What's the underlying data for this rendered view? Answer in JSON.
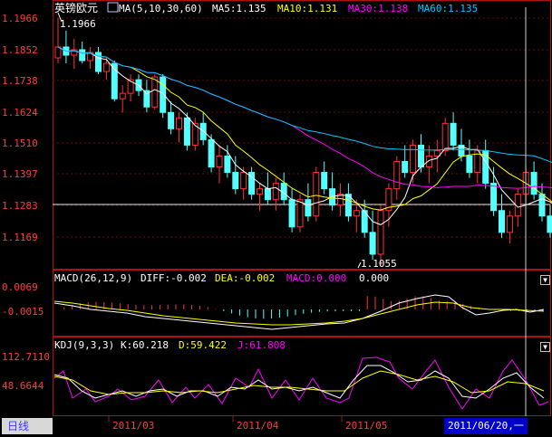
{
  "main_panel": {
    "symbol": "英镑欧元",
    "indicator": "MA(5,10,30,60)",
    "ma5": "MA5:1.135",
    "ma10": "MA10:1.131",
    "ma30": "MA30:1.138",
    "ma60": "MA60:1.135",
    "high_marker": "1.1966",
    "low_marker": "1.1055",
    "price_ticks": [
      "1.1966",
      "1.1852",
      "1.1738",
      "1.1624",
      "1.1510",
      "1.1397",
      "1.1283",
      "1.1169"
    ]
  },
  "macd_panel": {
    "indicator": "MACD(26,12,9)",
    "diff": "DIFF:-0.002",
    "dea": "DEA:-0.002",
    "macd": "MACD:0.000",
    "value": "0.000",
    "ticks": [
      "0.0069",
      "-0.0015"
    ]
  },
  "kdj_panel": {
    "indicator": "KDJ(9,3,3)",
    "k": "K:60.218",
    "d": "D:59.422",
    "j": "J:61.808",
    "ticks": [
      "112.7110",
      "48.6644"
    ]
  },
  "status_bar": {
    "period": "日线",
    "dates": [
      "2011/03",
      "2011/04",
      "2011/05"
    ],
    "cursor_date": "2011/06/20,一"
  },
  "colors": {
    "background": "#000000",
    "up": "#ff3232",
    "down": "#54ffff",
    "ma5": "#ffffff",
    "ma10": "#ffff00",
    "ma30": "#ff00ff",
    "ma60": "#00c8ff",
    "axis_text": "#ff3c3c"
  },
  "chart_data": {
    "type": "candlestick",
    "y_range": [
      1.105,
      1.1966
    ],
    "candles": [
      [
        1.182,
        1.1966,
        1.18,
        1.186
      ],
      [
        1.186,
        1.192,
        1.18,
        1.183
      ],
      [
        1.183,
        1.189,
        1.178,
        1.185
      ],
      [
        1.185,
        1.188,
        1.18,
        1.181
      ],
      [
        1.181,
        1.186,
        1.178,
        1.184
      ],
      [
        1.184,
        1.186,
        1.176,
        1.177
      ],
      [
        1.177,
        1.182,
        1.174,
        1.18
      ],
      [
        1.18,
        1.181,
        1.166,
        1.167
      ],
      [
        1.167,
        1.172,
        1.162,
        1.169
      ],
      [
        1.169,
        1.176,
        1.166,
        1.174
      ],
      [
        1.174,
        1.176,
        1.168,
        1.17
      ],
      [
        1.17,
        1.174,
        1.162,
        1.164
      ],
      [
        1.164,
        1.176,
        1.163,
        1.175
      ],
      [
        1.175,
        1.176,
        1.16,
        1.162
      ],
      [
        1.162,
        1.166,
        1.154,
        1.156
      ],
      [
        1.156,
        1.162,
        1.151,
        1.16
      ],
      [
        1.16,
        1.162,
        1.148,
        1.15
      ],
      [
        1.15,
        1.16,
        1.148,
        1.158
      ],
      [
        1.158,
        1.162,
        1.15,
        1.152
      ],
      [
        1.152,
        1.154,
        1.14,
        1.142
      ],
      [
        1.142,
        1.15,
        1.136,
        1.146
      ],
      [
        1.146,
        1.15,
        1.138,
        1.14
      ],
      [
        1.14,
        1.146,
        1.132,
        1.134
      ],
      [
        1.134,
        1.142,
        1.13,
        1.14
      ],
      [
        1.14,
        1.142,
        1.13,
        1.132
      ],
      [
        1.132,
        1.136,
        1.126,
        1.134
      ],
      [
        1.134,
        1.14,
        1.128,
        1.13
      ],
      [
        1.13,
        1.138,
        1.126,
        1.136
      ],
      [
        1.136,
        1.14,
        1.128,
        1.13
      ],
      [
        1.13,
        1.134,
        1.118,
        1.12
      ],
      [
        1.12,
        1.132,
        1.118,
        1.13
      ],
      [
        1.13,
        1.136,
        1.122,
        1.124
      ],
      [
        1.124,
        1.142,
        1.122,
        1.14
      ],
      [
        1.14,
        1.144,
        1.132,
        1.134
      ],
      [
        1.134,
        1.14,
        1.126,
        1.128
      ],
      [
        1.128,
        1.136,
        1.124,
        1.132
      ],
      [
        1.132,
        1.136,
        1.122,
        1.124
      ],
      [
        1.124,
        1.13,
        1.118,
        1.126
      ],
      [
        1.126,
        1.13,
        1.116,
        1.118
      ],
      [
        1.118,
        1.126,
        1.108,
        1.11
      ],
      [
        1.11,
        1.128,
        1.1055,
        1.126
      ],
      [
        1.126,
        1.136,
        1.12,
        1.134
      ],
      [
        1.134,
        1.146,
        1.13,
        1.144
      ],
      [
        1.144,
        1.15,
        1.138,
        1.14
      ],
      [
        1.14,
        1.152,
        1.136,
        1.15
      ],
      [
        1.15,
        1.154,
        1.14,
        1.142
      ],
      [
        1.142,
        1.15,
        1.136,
        1.146
      ],
      [
        1.146,
        1.152,
        1.14,
        1.148
      ],
      [
        1.148,
        1.16,
        1.146,
        1.158
      ],
      [
        1.158,
        1.162,
        1.148,
        1.15
      ],
      [
        1.15,
        1.156,
        1.144,
        1.146
      ],
      [
        1.146,
        1.152,
        1.138,
        1.14
      ],
      [
        1.14,
        1.15,
        1.136,
        1.148
      ],
      [
        1.148,
        1.152,
        1.134,
        1.136
      ],
      [
        1.136,
        1.142,
        1.124,
        1.126
      ],
      [
        1.126,
        1.132,
        1.116,
        1.118
      ],
      [
        1.118,
        1.126,
        1.114,
        1.124
      ],
      [
        1.124,
        1.134,
        1.12,
        1.132
      ],
      [
        1.132,
        1.142,
        1.128,
        1.14
      ],
      [
        1.14,
        1.144,
        1.13,
        1.132
      ],
      [
        1.132,
        1.136,
        1.122,
        1.124
      ],
      [
        1.124,
        1.128,
        1.116,
        1.118
      ],
      [
        1.118,
        1.124,
        1.116,
        1.122
      ]
    ]
  }
}
